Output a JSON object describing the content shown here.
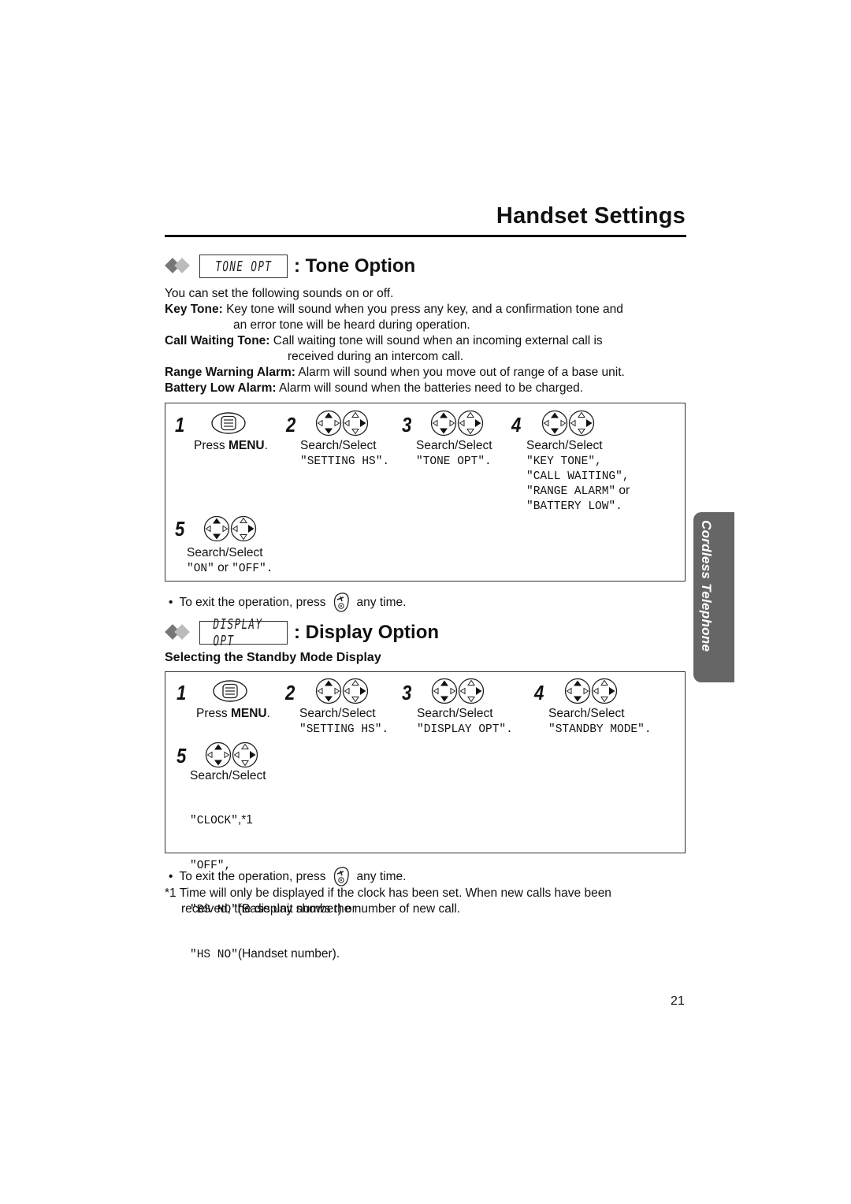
{
  "page": {
    "title": "Handset Settings",
    "page_number": "21",
    "side_tab": "Cordless Telephone"
  },
  "tone_option": {
    "lcd": "TONE OPT",
    "heading": ": Tone Option",
    "intro": "You can set the following sounds on or off.",
    "items": [
      {
        "term": "Key Tone:",
        "text": " Key tone will sound when you press any key, and a confirmation tone and",
        "cont": "an error tone will be heard during operation."
      },
      {
        "term": "Call Waiting Tone:",
        "text": " Call waiting tone will sound when an incoming external call is",
        "cont": "received during an intercom call."
      },
      {
        "term": "Range Warning Alarm:",
        "text": " Alarm will sound when you move out of range of a base unit."
      },
      {
        "term": "Battery Low Alarm:",
        "text": " Alarm will sound when the batteries need to be charged."
      }
    ],
    "steps": [
      {
        "num": "1",
        "icon": "menu-button-icon",
        "pre": "Press ",
        "bold": "MENU",
        "post": "."
      },
      {
        "num": "2",
        "icon": "navigator-key-icon",
        "label": "Search/Select",
        "values": [
          "\"SETTING HS\"."
        ]
      },
      {
        "num": "3",
        "icon": "navigator-key-icon",
        "label": "Search/Select",
        "values": [
          "\"TONE OPT\"."
        ]
      },
      {
        "num": "4",
        "icon": "navigator-key-icon",
        "label": "Search/Select",
        "values": [
          "\"KEY TONE\",",
          "\"CALL WAITING\",",
          "\"RANGE ALARM\"",
          "\"BATTERY LOW\"."
        ],
        "or_word": " or"
      },
      {
        "num": "5",
        "icon": "navigator-key-icon",
        "label": "Search/Select",
        "v1": "\"ON\"",
        "or_word": " or ",
        "v2": "\"OFF\"."
      }
    ],
    "exit_note": {
      "pre": "To exit the operation, press",
      "post": "any time.",
      "icon": "off-button-icon"
    }
  },
  "display_option": {
    "lcd": "DISPLAY OPT",
    "heading": ": Display Option",
    "subheading": "Selecting the Standby Mode Display",
    "steps": [
      {
        "num": "1",
        "icon": "menu-button-icon",
        "pre": "Press ",
        "bold": "MENU",
        "post": "."
      },
      {
        "num": "2",
        "icon": "navigator-key-icon",
        "label": "Search/Select",
        "values": [
          "\"SETTING HS\"."
        ]
      },
      {
        "num": "3",
        "icon": "navigator-key-icon",
        "label": "Search/Select",
        "values": [
          "\"DISPLAY OPT\"."
        ]
      },
      {
        "num": "4",
        "icon": "navigator-key-icon",
        "label": "Search/Select",
        "values": [
          "\"STANDBY MODE\"."
        ]
      },
      {
        "num": "5",
        "icon": "navigator-key-icon",
        "label": "Search/Select",
        "options": [
          {
            "mono": "\"CLOCK\"",
            "sans": ",*1"
          },
          {
            "mono": "\"OFF\",",
            "sans": ""
          },
          {
            "mono": "\"BS NO\"",
            "sans": "(Base unit number) or"
          },
          {
            "mono": "\"HS NO\"",
            "sans": "(Handset number)."
          }
        ]
      }
    ],
    "exit_note": {
      "pre": "To exit the operation, press",
      "post": "any time.",
      "icon": "off-button-icon"
    },
    "footnote": {
      "mark": "*1",
      "line1": "Time will only be displayed if the clock has been set. When new calls have been",
      "line2": "received, the display shows the number of new call."
    }
  }
}
